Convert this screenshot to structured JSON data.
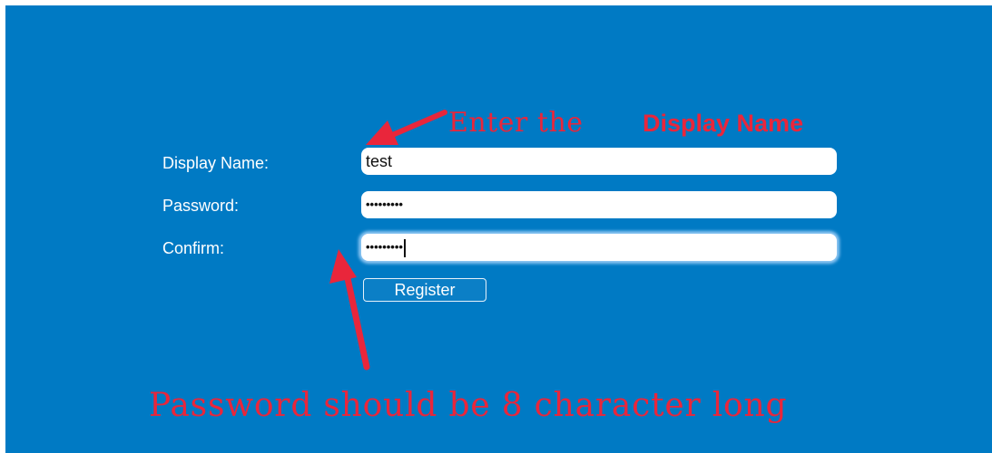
{
  "form": {
    "display_name_label": "Display Name:",
    "password_label": "Password:",
    "confirm_label": "Confirm:",
    "display_name_value": "test",
    "password_value": "•••••••••",
    "confirm_value": "•••••••••",
    "register_label": "Register"
  },
  "annotations": {
    "top_part1": "Enter the",
    "top_part2": "Display Name",
    "bottom": "Password should be 8 character long"
  },
  "colors": {
    "background": "#007ac4",
    "annotation": "#e9263b",
    "label_text": "#ffffff"
  },
  "icons": {
    "top_arrow": "arrow-icon",
    "bottom_arrow": "arrow-icon"
  }
}
